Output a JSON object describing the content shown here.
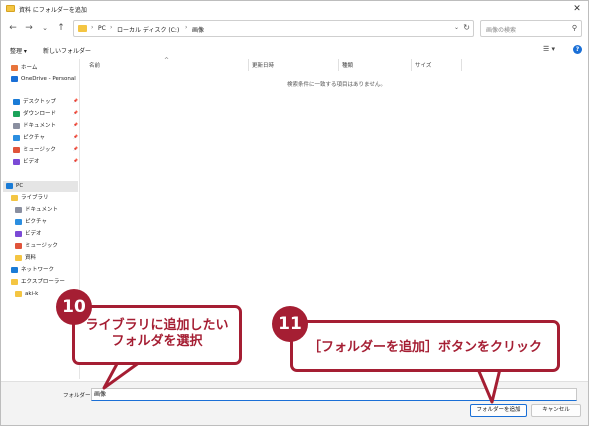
{
  "window": {
    "title": "資料 にフォルダーを追加",
    "close": "✕"
  },
  "nav": {
    "back": "←",
    "forward": "→",
    "dropdown": "⌄",
    "up": "↑"
  },
  "address": {
    "crumbs": [
      "PC",
      "ローカル ディスク (C:)",
      "画像"
    ],
    "separator": "›"
  },
  "search": {
    "placeholder": "画像の検索"
  },
  "toolbar": {
    "organize": "整理 ▾",
    "new_folder": "新しいフォルダー",
    "view": "☰ ▾",
    "help": "?"
  },
  "navpane": {
    "items": [
      {
        "label": "ホーム",
        "icon": "home-icon",
        "color": "#e8743b"
      },
      {
        "label": "OneDrive - Personal",
        "icon": "cloud-icon",
        "color": "#1a6fd6"
      },
      {
        "label": "デスクトップ",
        "icon": "desktop-icon",
        "color": "#1a7bd6",
        "pinned": true
      },
      {
        "label": "ダウンロード",
        "icon": "download-icon",
        "color": "#1aa35a",
        "pinned": true
      },
      {
        "label": "ドキュメント",
        "icon": "document-icon",
        "color": "#8a8fa0",
        "pinned": true
      },
      {
        "label": "ピクチャ",
        "icon": "picture-icon",
        "color": "#2b8ee0",
        "pinned": true
      },
      {
        "label": "ミュージック",
        "icon": "music-icon",
        "color": "#e0543b",
        "pinned": true
      },
      {
        "label": "ビデオ",
        "icon": "video-icon",
        "color": "#7b4ad6",
        "pinned": true
      },
      {
        "label": "PC",
        "icon": "pc-icon",
        "color": "#1a7bd6"
      },
      {
        "label": "ライブラリ",
        "icon": "library-icon",
        "color": "#f4c542"
      },
      {
        "label": "ドキュメント",
        "icon": "document-icon",
        "color": "#8a8fa0"
      },
      {
        "label": "ピクチャ",
        "icon": "picture-icon",
        "color": "#2b8ee0"
      },
      {
        "label": "ビデオ",
        "icon": "video-icon",
        "color": "#7b4ad6"
      },
      {
        "label": "ミュージック",
        "icon": "music-icon",
        "color": "#e0543b"
      },
      {
        "label": "資料",
        "icon": "folder-icon",
        "color": "#f4c542"
      },
      {
        "label": "ネットワーク",
        "icon": "network-icon",
        "color": "#1a7bd6"
      },
      {
        "label": "エクスプローラー",
        "icon": "explorer-icon",
        "color": "#f4c542"
      },
      {
        "label": "aki-k",
        "icon": "folder-icon",
        "color": "#f4c542"
      }
    ],
    "pin": "📌"
  },
  "columns": {
    "name": "名前",
    "date": "更新日時",
    "type": "種類",
    "size": "サイズ"
  },
  "content": {
    "empty_message": "検索条件に一致する項目はありません。"
  },
  "bottom": {
    "folder_label": "フォルダー:",
    "folder_value": "画像",
    "add_button": "フォルダーを追加",
    "cancel_button": "キャンセル"
  },
  "annotations": {
    "step1": {
      "number": "10",
      "line1": "ライブラリに追加したい",
      "line2": "フォルダを選択"
    },
    "step2": {
      "number": "11",
      "text": "［フォルダーを追加］ボタンをクリック"
    },
    "color": "#a51e33"
  }
}
